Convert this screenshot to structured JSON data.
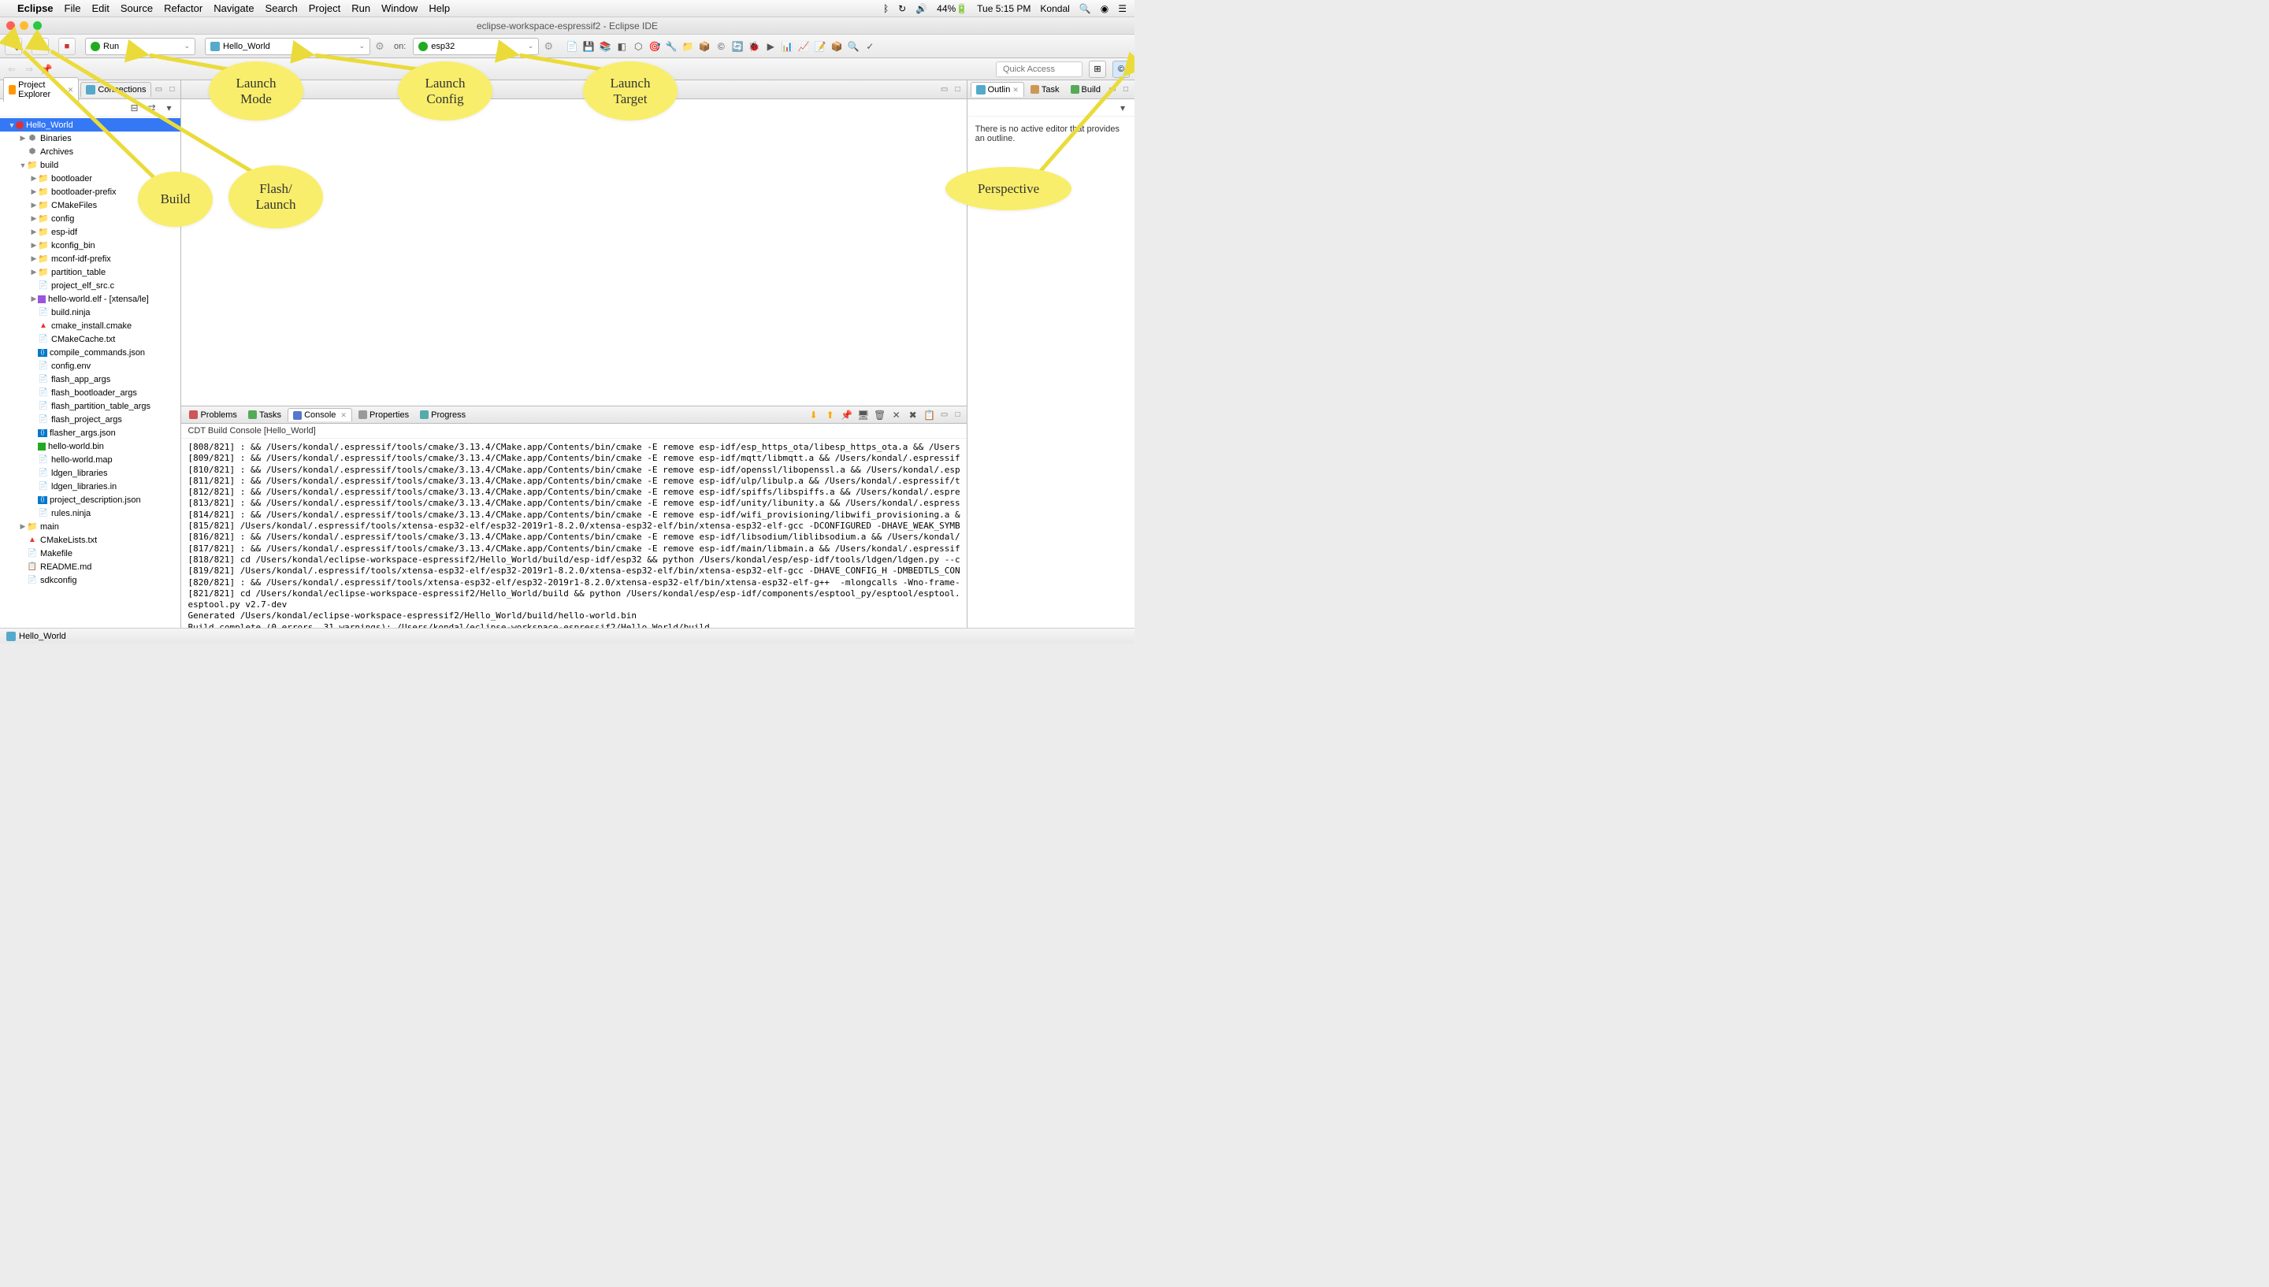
{
  "menubar": {
    "app": "Eclipse",
    "items": [
      "File",
      "Edit",
      "Source",
      "Refactor",
      "Navigate",
      "Search",
      "Project",
      "Run",
      "Window",
      "Help"
    ],
    "battery": "44%",
    "clock": "Tue 5:15 PM",
    "user": "Kondal"
  },
  "title": "eclipse-workspace-espressif2 - Eclipse IDE",
  "toolbar": {
    "launch_mode": "Run",
    "launch_config": "Hello_World",
    "on": "on:",
    "launch_target": "esp32",
    "quick_access": "Quick Access"
  },
  "views": {
    "project_explorer": "Project Explorer",
    "connections": "Connections",
    "outline": "Outlin",
    "task": "Task",
    "build": "Build"
  },
  "tree": {
    "root": "Hello_World",
    "binaries": "Binaries",
    "archives": "Archives",
    "build": "build",
    "build_children": [
      {
        "t": "fold",
        "n": "bootloader"
      },
      {
        "t": "fold",
        "n": "bootloader-prefix"
      },
      {
        "t": "fold",
        "n": "CMakeFiles"
      },
      {
        "t": "fold",
        "n": "config"
      },
      {
        "t": "fold",
        "n": "esp-idf"
      },
      {
        "t": "fold",
        "n": "kconfig_bin"
      },
      {
        "t": "fold",
        "n": "mconf-idf-prefix"
      },
      {
        "t": "fold",
        "n": "partition_table"
      },
      {
        "t": "file",
        "n": "project_elf_src.c",
        "i": "file"
      },
      {
        "t": "elf",
        "n": "hello-world.elf - [xtensa/le]",
        "i": "elf"
      },
      {
        "t": "file",
        "n": "build.ninja",
        "i": "file"
      },
      {
        "t": "file",
        "n": "cmake_install.cmake",
        "i": "cmk"
      },
      {
        "t": "file",
        "n": "CMakeCache.txt",
        "i": "file"
      },
      {
        "t": "file",
        "n": "compile_commands.json",
        "i": "json"
      },
      {
        "t": "file",
        "n": "config.env",
        "i": "file"
      },
      {
        "t": "file",
        "n": "flash_app_args",
        "i": "file"
      },
      {
        "t": "file",
        "n": "flash_bootloader_args",
        "i": "file"
      },
      {
        "t": "file",
        "n": "flash_partition_table_args",
        "i": "file"
      },
      {
        "t": "file",
        "n": "flash_project_args",
        "i": "file"
      },
      {
        "t": "file",
        "n": "flasher_args.json",
        "i": "json"
      },
      {
        "t": "file",
        "n": "hello-world.bin",
        "i": "binf"
      },
      {
        "t": "file",
        "n": "hello-world.map",
        "i": "file"
      },
      {
        "t": "file",
        "n": "ldgen_libraries",
        "i": "file"
      },
      {
        "t": "file",
        "n": "ldgen_libraries.in",
        "i": "file"
      },
      {
        "t": "file",
        "n": "project_description.json",
        "i": "json"
      },
      {
        "t": "file",
        "n": "rules.ninja",
        "i": "file"
      }
    ],
    "main": "main",
    "cmakelists": "CMakeLists.txt",
    "makefile": "Makefile",
    "readme": "README.md",
    "sdkconfig": "sdkconfig"
  },
  "bottom_tabs": [
    "Problems",
    "Tasks",
    "Console",
    "Properties",
    "Progress"
  ],
  "console_header": "CDT Build Console [Hello_World]",
  "console_lines": [
    "[808/821] : && /Users/kondal/.espressif/tools/cmake/3.13.4/CMake.app/Contents/bin/cmake -E remove esp-idf/esp_https_ota/libesp_https_ota.a && /Users",
    "[809/821] : && /Users/kondal/.espressif/tools/cmake/3.13.4/CMake.app/Contents/bin/cmake -E remove esp-idf/mqtt/libmqtt.a && /Users/kondal/.espressif",
    "[810/821] : && /Users/kondal/.espressif/tools/cmake/3.13.4/CMake.app/Contents/bin/cmake -E remove esp-idf/openssl/libopenssl.a && /Users/kondal/.esp",
    "[811/821] : && /Users/kondal/.espressif/tools/cmake/3.13.4/CMake.app/Contents/bin/cmake -E remove esp-idf/ulp/libulp.a && /Users/kondal/.espressif/t",
    "[812/821] : && /Users/kondal/.espressif/tools/cmake/3.13.4/CMake.app/Contents/bin/cmake -E remove esp-idf/spiffs/libspiffs.a && /Users/kondal/.espre",
    "[813/821] : && /Users/kondal/.espressif/tools/cmake/3.13.4/CMake.app/Contents/bin/cmake -E remove esp-idf/unity/libunity.a && /Users/kondal/.espress",
    "[814/821] : && /Users/kondal/.espressif/tools/cmake/3.13.4/CMake.app/Contents/bin/cmake -E remove esp-idf/wifi_provisioning/libwifi_provisioning.a &",
    "[815/821] /Users/kondal/.espressif/tools/xtensa-esp32-elf/esp32-2019r1-8.2.0/xtensa-esp32-elf/bin/xtensa-esp32-elf-gcc -DCONFIGURED -DHAVE_WEAK_SYMB",
    "[816/821] : && /Users/kondal/.espressif/tools/cmake/3.13.4/CMake.app/Contents/bin/cmake -E remove esp-idf/libsodium/liblibsodium.a && /Users/kondal/",
    "[817/821] : && /Users/kondal/.espressif/tools/cmake/3.13.4/CMake.app/Contents/bin/cmake -E remove esp-idf/main/libmain.a && /Users/kondal/.espressif",
    "[818/821] cd /Users/kondal/eclipse-workspace-espressif2/Hello_World/build/esp-idf/esp32 && python /Users/kondal/esp/esp-idf/tools/ldgen/ldgen.py --c",
    "[819/821] /Users/kondal/.espressif/tools/xtensa-esp32-elf/esp32-2019r1-8.2.0/xtensa-esp32-elf/bin/xtensa-esp32-elf-gcc -DHAVE_CONFIG_H -DMBEDTLS_CON",
    "[820/821] : && /Users/kondal/.espressif/tools/xtensa-esp32-elf/esp32-2019r1-8.2.0/xtensa-esp32-elf/bin/xtensa-esp32-elf-g++  -mlongcalls -Wno-frame-",
    "[821/821] cd /Users/kondal/eclipse-workspace-espressif2/Hello_World/build && python /Users/kondal/esp/esp-idf/components/esptool_py/esptool/esptool.",
    "esptool.py v2.7-dev",
    "Generated /Users/kondal/eclipse-workspace-espressif2/Hello_World/build/hello-world.bin",
    "Build complete (0 errors, 31 warnings): /Users/kondal/eclipse-workspace-espressif2/Hello_World/build"
  ],
  "outline_msg": "There is no active editor that provides an outline.",
  "status_text": "Hello_World",
  "annotations": {
    "build": "Build",
    "flash": "Flash/\nLaunch",
    "mode": "Launch\nMode",
    "config": "Launch\nConfig",
    "target": "Launch\nTarget",
    "perspective": "Perspective"
  }
}
